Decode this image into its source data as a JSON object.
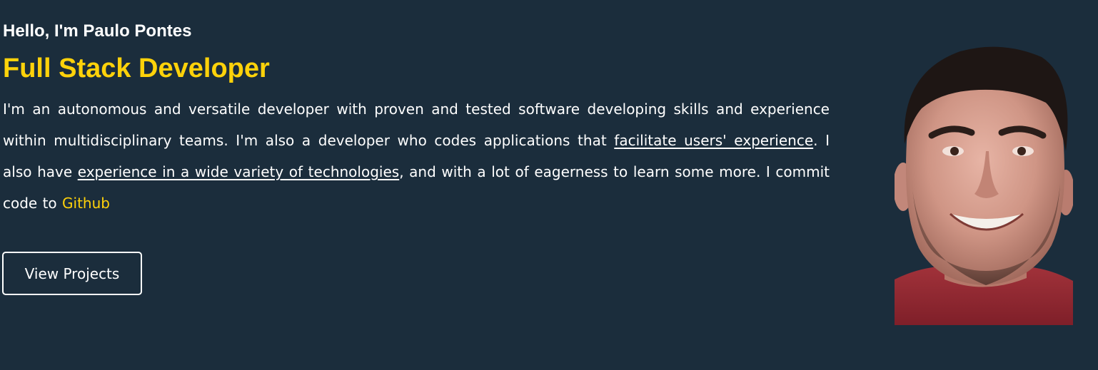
{
  "hero": {
    "greeting": "Hello, I'm Paulo Pontes",
    "role": "Full Stack Developer",
    "bio": {
      "text_1": "I'm an autonomous and versatile developer with proven and tested software developing skills and experience within multidisciplinary teams. I'm also a developer who codes applications that ",
      "link_1": "facilitate users' experience",
      "text_2": ". I also have ",
      "link_2": "experience in a wide variety of technologies",
      "text_3": ", and with a lot of eagerness to learn some more. I commit code to ",
      "github_link": "Github"
    },
    "cta_label": "View Projects",
    "photo_alt": "Paulo Pontes portrait",
    "colors": {
      "background": "#1b2d3c",
      "accent": "#ffd20a",
      "text": "#ffffff"
    }
  }
}
